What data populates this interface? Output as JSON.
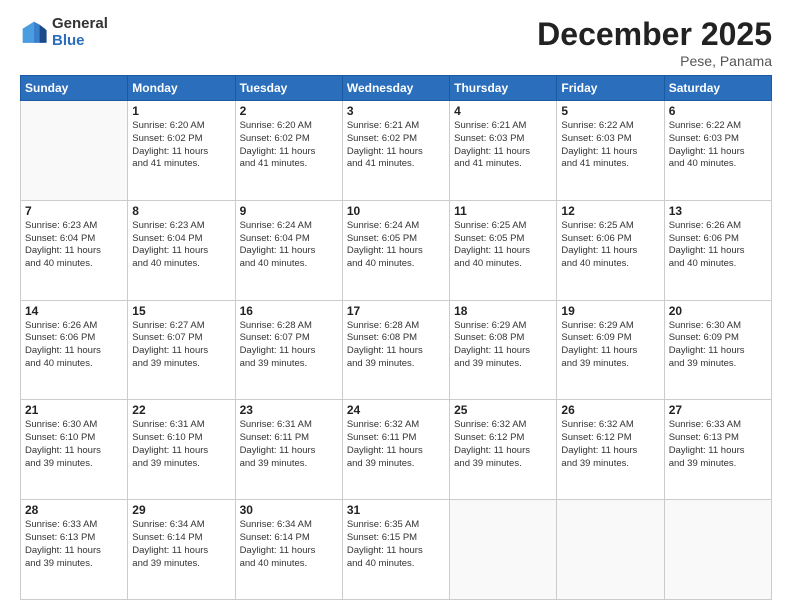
{
  "logo": {
    "general": "General",
    "blue": "Blue"
  },
  "title": "December 2025",
  "subtitle": "Pese, Panama",
  "days_of_week": [
    "Sunday",
    "Monday",
    "Tuesday",
    "Wednesday",
    "Thursday",
    "Friday",
    "Saturday"
  ],
  "weeks": [
    [
      {
        "day": "",
        "info": ""
      },
      {
        "day": "1",
        "info": "Sunrise: 6:20 AM\nSunset: 6:02 PM\nDaylight: 11 hours\nand 41 minutes."
      },
      {
        "day": "2",
        "info": "Sunrise: 6:20 AM\nSunset: 6:02 PM\nDaylight: 11 hours\nand 41 minutes."
      },
      {
        "day": "3",
        "info": "Sunrise: 6:21 AM\nSunset: 6:02 PM\nDaylight: 11 hours\nand 41 minutes."
      },
      {
        "day": "4",
        "info": "Sunrise: 6:21 AM\nSunset: 6:03 PM\nDaylight: 11 hours\nand 41 minutes."
      },
      {
        "day": "5",
        "info": "Sunrise: 6:22 AM\nSunset: 6:03 PM\nDaylight: 11 hours\nand 41 minutes."
      },
      {
        "day": "6",
        "info": "Sunrise: 6:22 AM\nSunset: 6:03 PM\nDaylight: 11 hours\nand 40 minutes."
      }
    ],
    [
      {
        "day": "7",
        "info": "Sunrise: 6:23 AM\nSunset: 6:04 PM\nDaylight: 11 hours\nand 40 minutes."
      },
      {
        "day": "8",
        "info": "Sunrise: 6:23 AM\nSunset: 6:04 PM\nDaylight: 11 hours\nand 40 minutes."
      },
      {
        "day": "9",
        "info": "Sunrise: 6:24 AM\nSunset: 6:04 PM\nDaylight: 11 hours\nand 40 minutes."
      },
      {
        "day": "10",
        "info": "Sunrise: 6:24 AM\nSunset: 6:05 PM\nDaylight: 11 hours\nand 40 minutes."
      },
      {
        "day": "11",
        "info": "Sunrise: 6:25 AM\nSunset: 6:05 PM\nDaylight: 11 hours\nand 40 minutes."
      },
      {
        "day": "12",
        "info": "Sunrise: 6:25 AM\nSunset: 6:06 PM\nDaylight: 11 hours\nand 40 minutes."
      },
      {
        "day": "13",
        "info": "Sunrise: 6:26 AM\nSunset: 6:06 PM\nDaylight: 11 hours\nand 40 minutes."
      }
    ],
    [
      {
        "day": "14",
        "info": "Sunrise: 6:26 AM\nSunset: 6:06 PM\nDaylight: 11 hours\nand 40 minutes."
      },
      {
        "day": "15",
        "info": "Sunrise: 6:27 AM\nSunset: 6:07 PM\nDaylight: 11 hours\nand 39 minutes."
      },
      {
        "day": "16",
        "info": "Sunrise: 6:28 AM\nSunset: 6:07 PM\nDaylight: 11 hours\nand 39 minutes."
      },
      {
        "day": "17",
        "info": "Sunrise: 6:28 AM\nSunset: 6:08 PM\nDaylight: 11 hours\nand 39 minutes."
      },
      {
        "day": "18",
        "info": "Sunrise: 6:29 AM\nSunset: 6:08 PM\nDaylight: 11 hours\nand 39 minutes."
      },
      {
        "day": "19",
        "info": "Sunrise: 6:29 AM\nSunset: 6:09 PM\nDaylight: 11 hours\nand 39 minutes."
      },
      {
        "day": "20",
        "info": "Sunrise: 6:30 AM\nSunset: 6:09 PM\nDaylight: 11 hours\nand 39 minutes."
      }
    ],
    [
      {
        "day": "21",
        "info": "Sunrise: 6:30 AM\nSunset: 6:10 PM\nDaylight: 11 hours\nand 39 minutes."
      },
      {
        "day": "22",
        "info": "Sunrise: 6:31 AM\nSunset: 6:10 PM\nDaylight: 11 hours\nand 39 minutes."
      },
      {
        "day": "23",
        "info": "Sunrise: 6:31 AM\nSunset: 6:11 PM\nDaylight: 11 hours\nand 39 minutes."
      },
      {
        "day": "24",
        "info": "Sunrise: 6:32 AM\nSunset: 6:11 PM\nDaylight: 11 hours\nand 39 minutes."
      },
      {
        "day": "25",
        "info": "Sunrise: 6:32 AM\nSunset: 6:12 PM\nDaylight: 11 hours\nand 39 minutes."
      },
      {
        "day": "26",
        "info": "Sunrise: 6:32 AM\nSunset: 6:12 PM\nDaylight: 11 hours\nand 39 minutes."
      },
      {
        "day": "27",
        "info": "Sunrise: 6:33 AM\nSunset: 6:13 PM\nDaylight: 11 hours\nand 39 minutes."
      }
    ],
    [
      {
        "day": "28",
        "info": "Sunrise: 6:33 AM\nSunset: 6:13 PM\nDaylight: 11 hours\nand 39 minutes."
      },
      {
        "day": "29",
        "info": "Sunrise: 6:34 AM\nSunset: 6:14 PM\nDaylight: 11 hours\nand 39 minutes."
      },
      {
        "day": "30",
        "info": "Sunrise: 6:34 AM\nSunset: 6:14 PM\nDaylight: 11 hours\nand 40 minutes."
      },
      {
        "day": "31",
        "info": "Sunrise: 6:35 AM\nSunset: 6:15 PM\nDaylight: 11 hours\nand 40 minutes."
      },
      {
        "day": "",
        "info": ""
      },
      {
        "day": "",
        "info": ""
      },
      {
        "day": "",
        "info": ""
      }
    ]
  ]
}
